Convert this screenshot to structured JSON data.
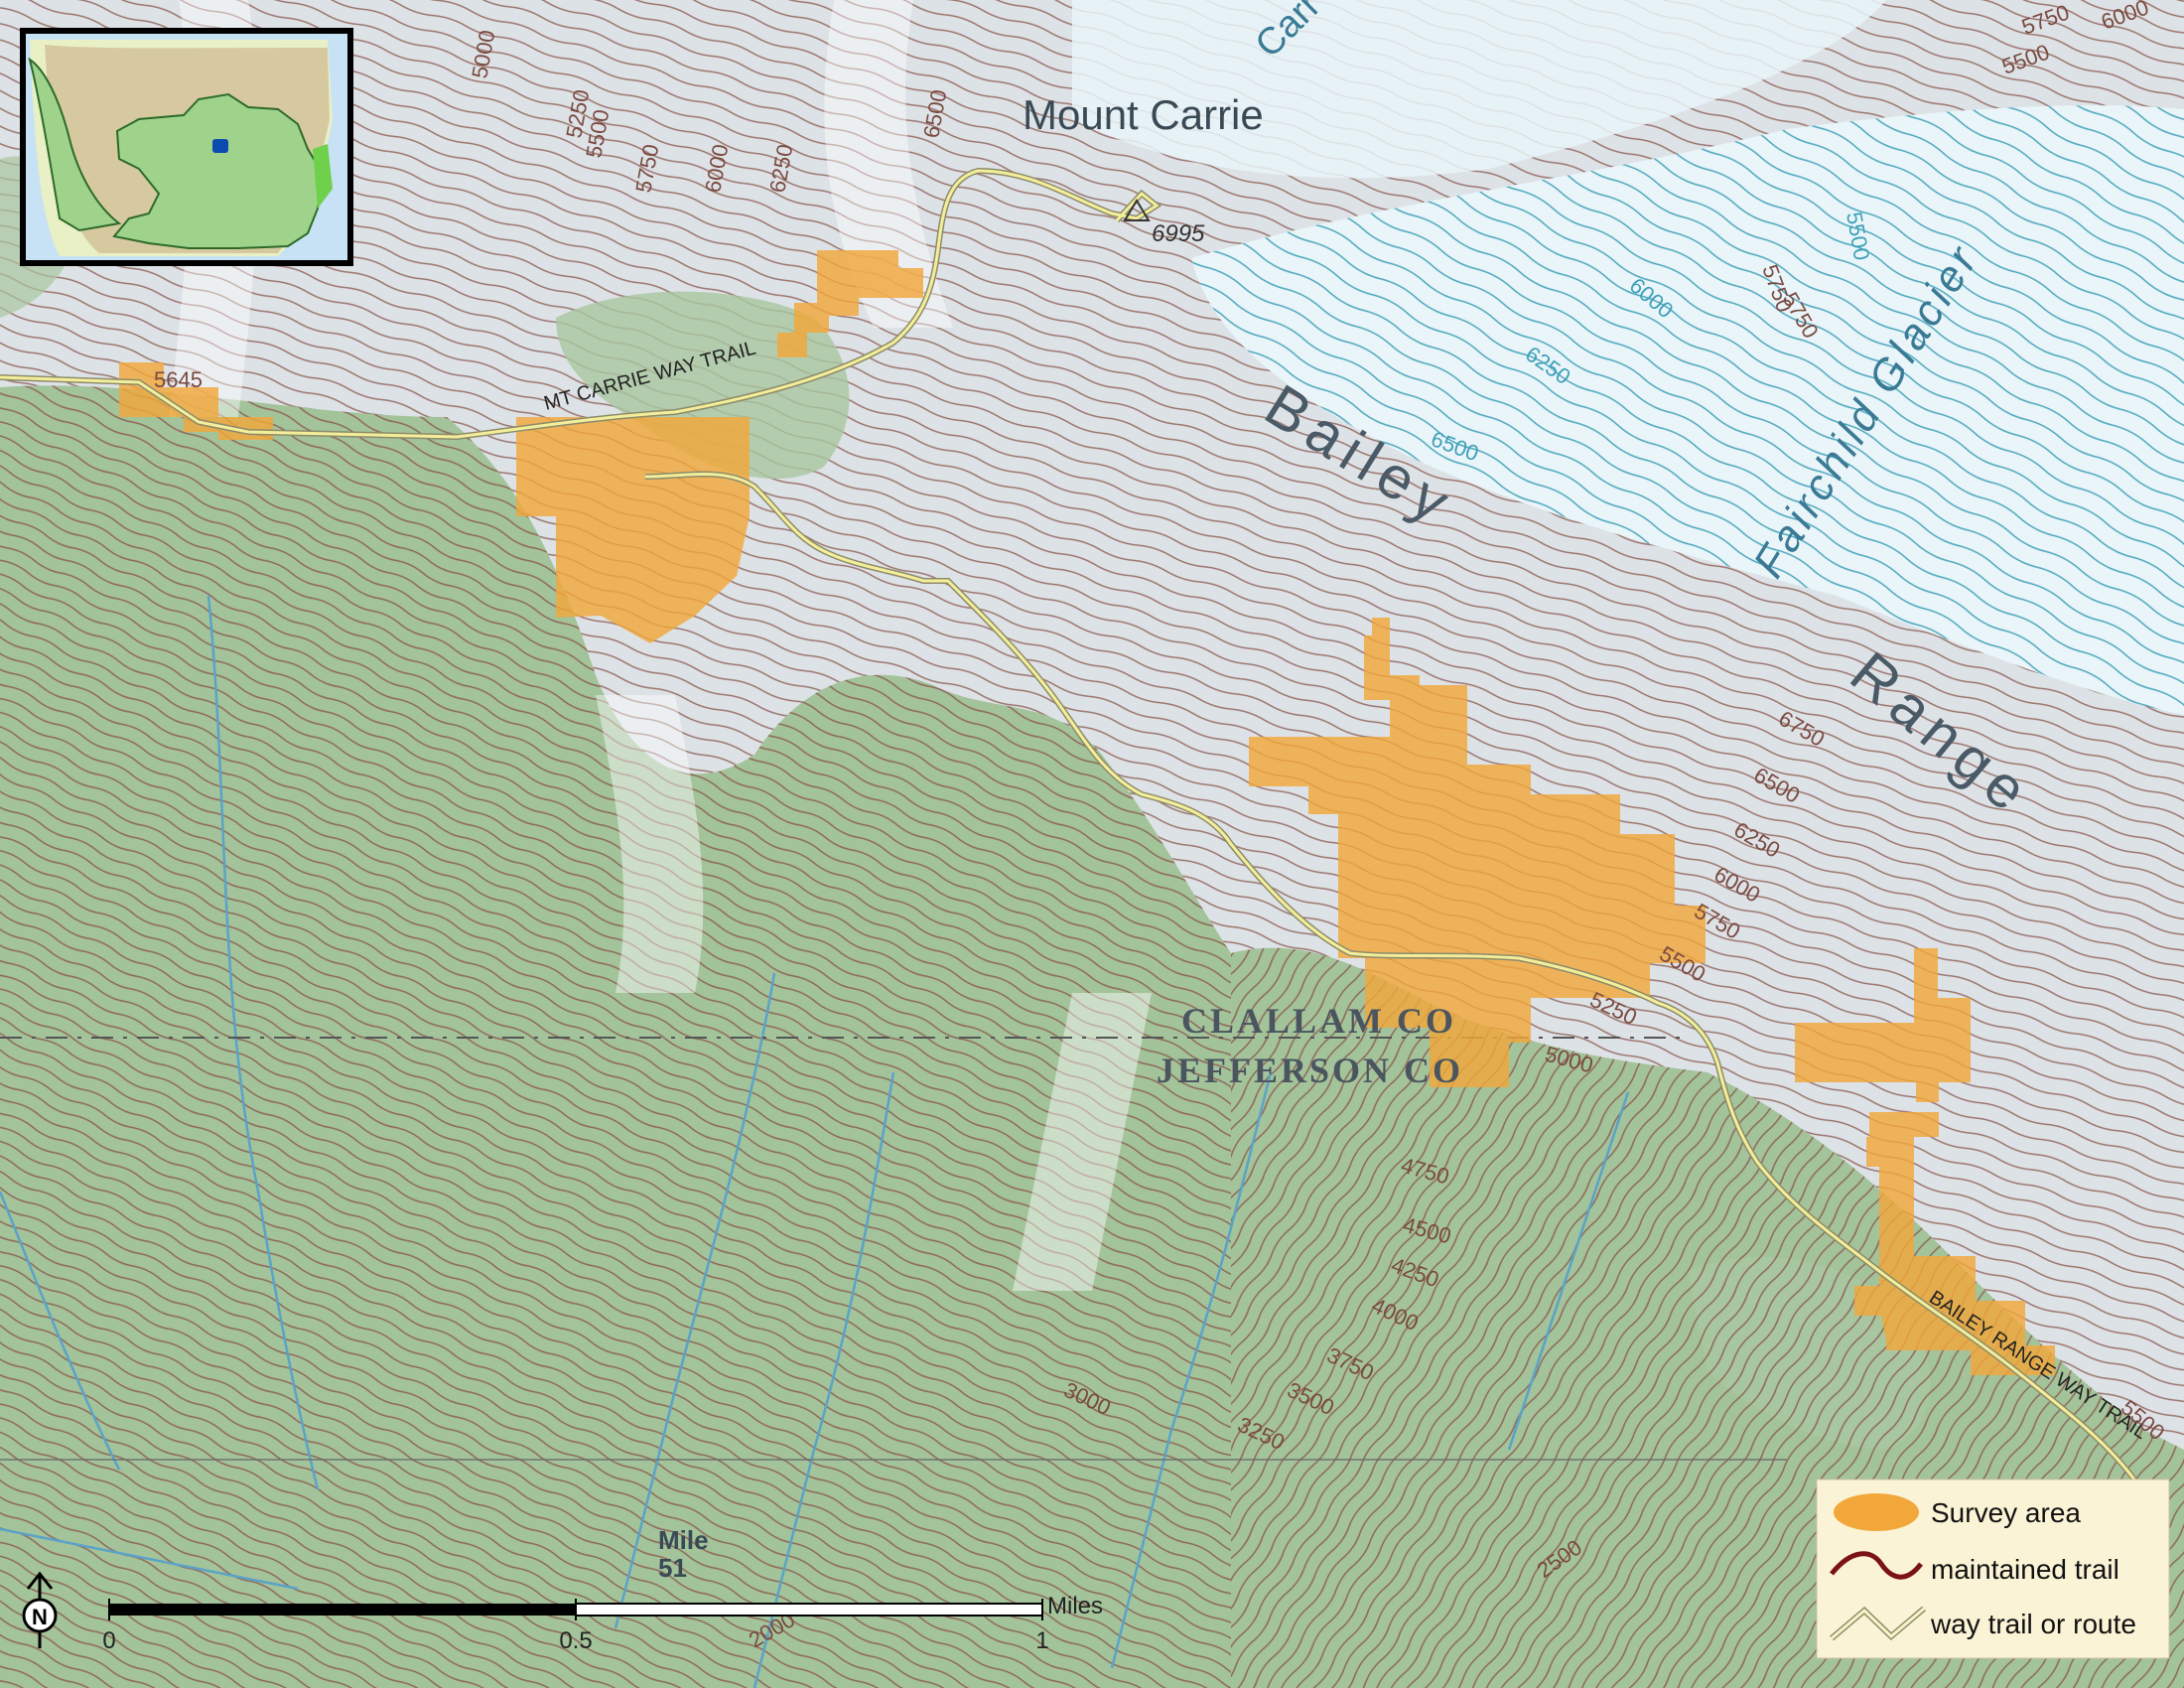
{
  "places": {
    "peak_name": "Mount Carrie",
    "peak_elev": "6995",
    "elev_near_trailhead": "5645",
    "range_word1": "Bailey",
    "range_word2": "Range",
    "glacier": "Fairchild Glacier",
    "county_north": "CLALLAM CO",
    "county_south": "JEFFERSON CO",
    "mile_label_1": "Mile",
    "mile_label_2": "51",
    "partial_peak_label": "Carr"
  },
  "trails": {
    "mt_carrie": "MT CARRIE WAY TRAIL",
    "bailey_range": "BAILEY RANGE WAY TRAIL"
  },
  "contour_labels": [
    "5000",
    "5250",
    "5500",
    "5750",
    "6000",
    "6250",
    "6500",
    "6000",
    "5750",
    "5500",
    "6250",
    "6500",
    "6750",
    "6500",
    "6250",
    "6000",
    "5750",
    "5500",
    "5250",
    "5000",
    "4750",
    "4500",
    "4250",
    "4000",
    "3750",
    "3500",
    "3250",
    "3000",
    "5750",
    "5500",
    "6000",
    "5750",
    "5500",
    "2000",
    "2500"
  ],
  "scale_bar": {
    "unit": "Miles",
    "ticks": [
      "0",
      "0.5",
      "1"
    ]
  },
  "north_arrow": "N",
  "legend": {
    "items": [
      {
        "label": "Survey area",
        "symbol": "orange-ellipse",
        "color": "#f2a73a"
      },
      {
        "label": "maintained trail",
        "symbol": "dark-red-line",
        "color": "#7a1414"
      },
      {
        "label": "way trail or route",
        "symbol": "double-line",
        "color": "#f5f0a0"
      }
    ]
  },
  "colors": {
    "forest": "#9fc096",
    "rock": "#d8dde3",
    "glacier": "#e8f4f8",
    "contour": "#8b5a4f",
    "glacier_contour": "#3fa0b8",
    "survey": "#f2a73a",
    "trail": "#f4ee9a",
    "stream": "#5aa3c8"
  }
}
